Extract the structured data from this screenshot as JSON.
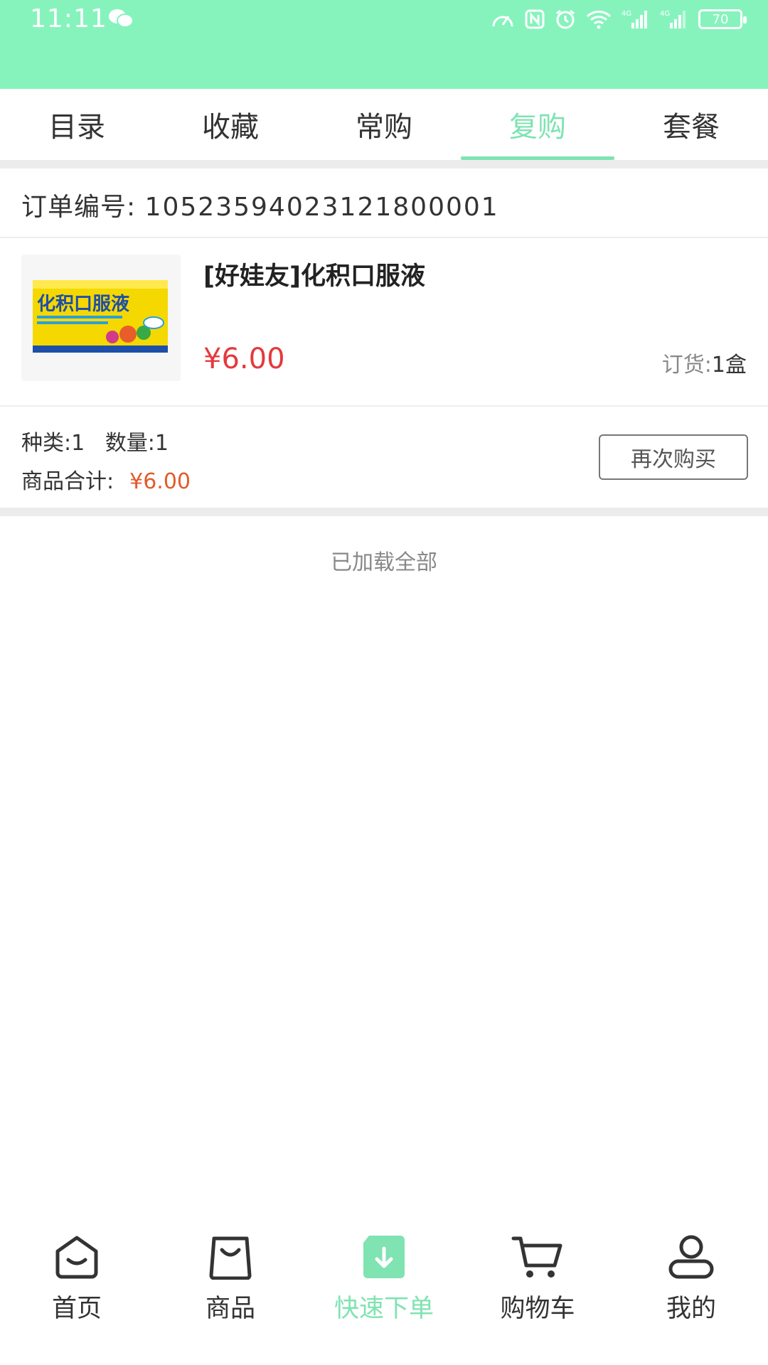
{
  "status_bar": {
    "time": "11:11",
    "battery": "70",
    "net1": "4G",
    "net2": "4G"
  },
  "tabs": [
    {
      "label": "目录",
      "active": false
    },
    {
      "label": "收藏",
      "active": false
    },
    {
      "label": "常购",
      "active": false
    },
    {
      "label": "复购",
      "active": true
    },
    {
      "label": "套餐",
      "active": false
    }
  ],
  "order": {
    "number_label": "订单编号:",
    "number": "105235940231218 00001",
    "number_value": "10523594023121800001"
  },
  "product": {
    "name": "[好娃友]化积口服液",
    "price": "¥6.00",
    "qty_label": "订货:",
    "qty_value": "1盒",
    "image_text": "化积口服液"
  },
  "summary": {
    "kinds": "种类:1",
    "count": "数量:1",
    "total_label": "商品合计:",
    "total": "¥6.00",
    "rebuy_button": "再次购买"
  },
  "list_footer": "已加载全部",
  "bottom_nav": [
    {
      "label": "首页",
      "icon": "home-icon"
    },
    {
      "label": "商品",
      "icon": "bag-icon"
    },
    {
      "label": "快速下单",
      "icon": "quick-order-icon",
      "active": true
    },
    {
      "label": "购物车",
      "icon": "cart-icon"
    },
    {
      "label": "我的",
      "icon": "user-icon"
    }
  ],
  "colors": {
    "accent": "#7fe3b2",
    "status_bar": "#86f3bd",
    "price_red": "#e4393c"
  }
}
